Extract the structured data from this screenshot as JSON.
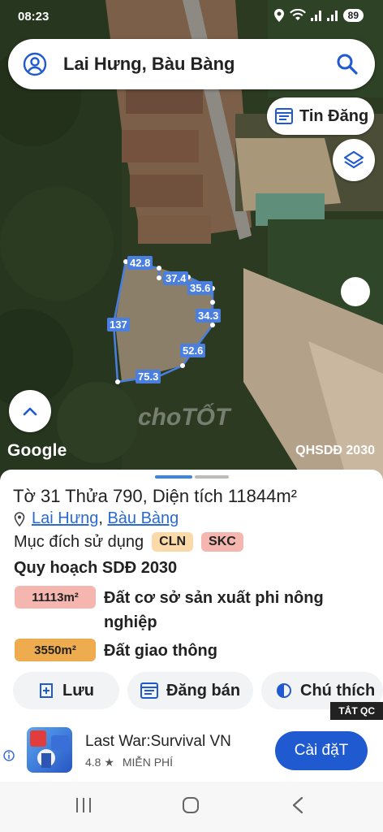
{
  "status": {
    "time": "08:23",
    "battery": "89"
  },
  "search": {
    "title": "Lai Hưng, Bàu Bàng"
  },
  "map": {
    "tin_dang_label": "Tin Đăng",
    "google_label": "Google",
    "overlay_label": "QHSDĐ 2030",
    "watermark": "choTỐT",
    "plot_labels": [
      "42.8",
      "37.4",
      "35.6",
      "34.3",
      "137",
      "52.6",
      "75.3"
    ]
  },
  "parcel": {
    "prefix": "Tờ ",
    "sheet": "31",
    "mid": " Thửa ",
    "plot": "790",
    "area_prefix": ", Diện tích ",
    "area": "11844m²",
    "location_a": "Lai Hưng",
    "location_sep": ",",
    "location_b": "Bàu Bàng",
    "purpose_label": "Mục đích sử dụng",
    "purpose_codes": [
      "CLN",
      "SKC"
    ],
    "plan_title": "Quy hoạch SDĐ 2030",
    "land_uses": [
      {
        "area": "11113m²",
        "name": "Đất cơ sở sản xuất phi nông nghiệp",
        "color": "#f4b6ae"
      },
      {
        "area": "3550m²",
        "name": "Đất giao thông",
        "color": "#eeac4e"
      }
    ]
  },
  "actions": {
    "save": "Lưu",
    "sell": "Đăng bán",
    "legend": "Chú thích"
  },
  "ad": {
    "close_label": "TẮT QC",
    "app_name": "Last War:Survival VN",
    "rating": "4.8",
    "price": "MIỄN PHÍ",
    "install": "Cài đặT"
  },
  "colors": {
    "accent": "#1f5ad1",
    "link": "#2a6bd1",
    "plot_label_bg": "#4a7fe0"
  }
}
